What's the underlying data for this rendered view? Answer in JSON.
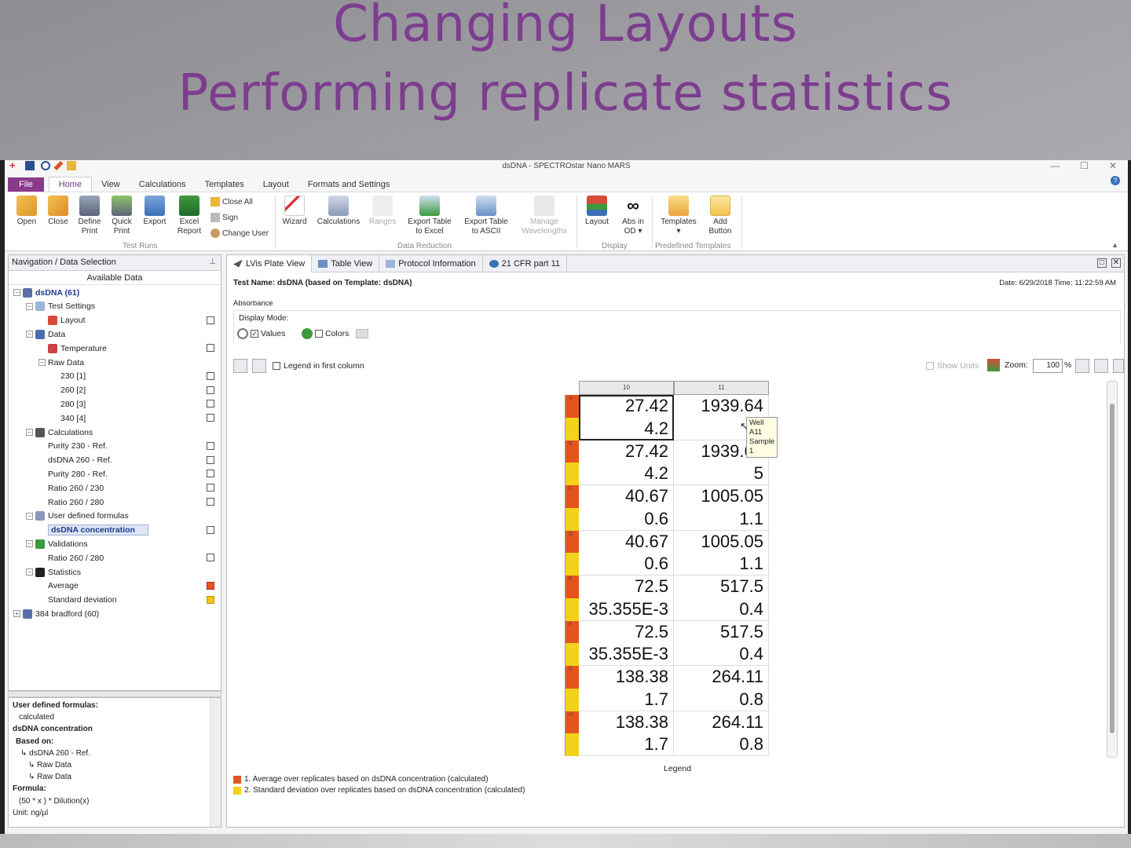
{
  "slide": {
    "title_line1": "Changing Layouts",
    "title_line2": "Performing replicate statistics"
  },
  "window": {
    "title": "dsDNA - SPECTROstar Nano MARS",
    "controls": [
      "—",
      "☐",
      "✕"
    ]
  },
  "ribbon_tabs": [
    "File",
    "Home",
    "View",
    "Calculations",
    "Templates",
    "Layout",
    "Formats and Settings"
  ],
  "ribbon": {
    "open": "Open",
    "close": "Close",
    "define_print": [
      "Define",
      "Print"
    ],
    "quick_print": [
      "Quick",
      "Print"
    ],
    "export": "Export",
    "excel_report": [
      "Excel",
      "Report"
    ],
    "close_all": "Close All",
    "sign": "Sign",
    "change_user": "Change User",
    "group_test_runs": "Test Runs",
    "wizard": "Wizard",
    "calculations": "Calculations",
    "ranges": "Ranges",
    "export_table_excel": [
      "Export Table",
      "to Excel"
    ],
    "export_table_ascii": [
      "Export Table",
      "to ASCII"
    ],
    "manage_wavelengths": [
      "Manage",
      "Wavelengths"
    ],
    "group_data_reduction": "Data Reduction",
    "layout": "Layout",
    "abs_in_od": [
      "Abs in",
      "OD ▾"
    ],
    "group_display": "Display",
    "templates": [
      "Templates",
      "▾"
    ],
    "add_button": [
      "Add",
      "Button"
    ],
    "group_predefined_templates": "Predefined Templates"
  },
  "nav": {
    "header": "Navigation / Data Selection",
    "available": "Available Data",
    "items": [
      {
        "label": "dsDNA (61)",
        "level": 0,
        "exp": "−",
        "icon": "#5a6fa8",
        "chk": "",
        "style": "bold"
      },
      {
        "label": "Test Settings",
        "level": 1,
        "exp": "−",
        "icon": "#9bb4d8",
        "chk": ""
      },
      {
        "label": "Layout",
        "level": 2,
        "exp": "",
        "icon": "#d64b3a",
        "chk": "empty"
      },
      {
        "label": "Data",
        "level": 1,
        "exp": "−",
        "icon": "#4a6fae",
        "chk": ""
      },
      {
        "label": "Temperature",
        "level": 2,
        "exp": "",
        "icon": "#c44",
        "chk": "empty"
      },
      {
        "label": "Raw Data",
        "level": 2,
        "exp": "−",
        "icon": "",
        "chk": ""
      },
      {
        "label": "230 [1]",
        "level": 3,
        "exp": "",
        "icon": "",
        "chk": "empty"
      },
      {
        "label": "260 [2]",
        "level": 3,
        "exp": "",
        "icon": "",
        "chk": "empty"
      },
      {
        "label": "280 [3]",
        "level": 3,
        "exp": "",
        "icon": "",
        "chk": "empty"
      },
      {
        "label": "340 [4]",
        "level": 3,
        "exp": "",
        "icon": "",
        "chk": "empty"
      },
      {
        "label": "Calculations",
        "level": 1,
        "exp": "−",
        "icon": "#555",
        "chk": ""
      },
      {
        "label": "Purity 230 - Ref.",
        "level": 2,
        "exp": "",
        "icon": "",
        "chk": "empty"
      },
      {
        "label": "dsDNA 260 - Ref.",
        "level": 2,
        "exp": "",
        "icon": "",
        "chk": "empty"
      },
      {
        "label": "Purity 280  - Ref.",
        "level": 2,
        "exp": "",
        "icon": "",
        "chk": "empty"
      },
      {
        "label": "Ratio 260 / 230",
        "level": 2,
        "exp": "",
        "icon": "",
        "chk": "empty"
      },
      {
        "label": "Ratio 260 / 280",
        "level": 2,
        "exp": "",
        "icon": "",
        "chk": "empty"
      },
      {
        "label": "User defined formulas",
        "level": 1,
        "exp": "−",
        "icon": "#8899bb",
        "chk": ""
      },
      {
        "label": "dsDNA concentration",
        "level": 2,
        "exp": "",
        "icon": "",
        "chk": "empty",
        "style": "sel"
      },
      {
        "label": "Validations",
        "level": 1,
        "exp": "−",
        "icon": "#3c9a3c",
        "chk": ""
      },
      {
        "label": "Ratio 260 / 280",
        "level": 2,
        "exp": "",
        "icon": "",
        "chk": "empty"
      },
      {
        "label": "Statistics",
        "level": 1,
        "exp": "−",
        "icon": "#222",
        "chk": ""
      },
      {
        "label": "Average",
        "level": 2,
        "exp": "",
        "icon": "",
        "chk": "red"
      },
      {
        "label": "Standard deviation",
        "level": 2,
        "exp": "",
        "icon": "",
        "chk": "yellow"
      },
      {
        "label": "384 bradford (60)",
        "level": 0,
        "exp": "+",
        "icon": "#5a6fa8",
        "chk": ""
      }
    ]
  },
  "info": {
    "heading": "User defined formulas:",
    "sub": "calculated",
    "name": "dsDNA concentration",
    "based_on_label": "Based on:",
    "based_on": [
      "↳ dsDNA 260 - Ref.",
      "↳ Raw Data",
      "↳ Raw Data"
    ],
    "formula_label": "Formula:",
    "formula": "(50  * x ) * Dilution(x)",
    "unit": "Unit: ng/µl"
  },
  "view_tabs": [
    "LVis Plate View",
    "Table View",
    "Protocol Information",
    "21 CFR part 11"
  ],
  "content": {
    "test_name": "Test Name: dsDNA (based on Template: dsDNA)",
    "datetime": "Date: 6/29/2018  Time: 11:22:59 AM",
    "absorbance": "Absorbance",
    "display_mode": "Display Mode:",
    "values": "Values",
    "colors": "Colors",
    "legend_first_col": "Legend in first column",
    "show_units": "Show Units",
    "zoom_label": "Zoom:",
    "zoom_value": "100",
    "zoom_pct": "%"
  },
  "grid": {
    "columns": [
      "10",
      "11"
    ],
    "rows": [
      {
        "label": "A",
        "c10": [
          "27.42",
          "4.2"
        ],
        "c11": [
          "1939.64",
          ""
        ]
      },
      {
        "label": "B",
        "c10": [
          "27.42",
          "4.2"
        ],
        "c11": [
          "1939.64",
          "5"
        ]
      },
      {
        "label": "C",
        "c10": [
          "40.67",
          "0.6"
        ],
        "c11": [
          "1005.05",
          "1.1"
        ]
      },
      {
        "label": "D",
        "c10": [
          "40.67",
          "0.6"
        ],
        "c11": [
          "1005.05",
          "1.1"
        ]
      },
      {
        "label": "E",
        "c10": [
          "72.5",
          "35.355E-3"
        ],
        "c11": [
          "517.5",
          "0.4"
        ]
      },
      {
        "label": "F",
        "c10": [
          "72.5",
          "35.355E-3"
        ],
        "c11": [
          "517.5",
          "0.4"
        ]
      },
      {
        "label": "G",
        "c10": [
          "138.38",
          "1.7"
        ],
        "c11": [
          "264.11",
          "0.8"
        ]
      },
      {
        "label": "H",
        "c10": [
          "138.38",
          "1.7"
        ],
        "c11": [
          "264.11",
          "0.8"
        ]
      }
    ],
    "tooltip": [
      "Well A11",
      "Sample 1"
    ]
  },
  "legend": {
    "title": "Legend",
    "items": [
      "1. Average over replicates based on dsDNA concentration (calculated)",
      "2. Standard deviation over replicates based on dsDNA concentration (calculated)"
    ],
    "colors": [
      "#e2561e",
      "#f3d21b"
    ]
  }
}
